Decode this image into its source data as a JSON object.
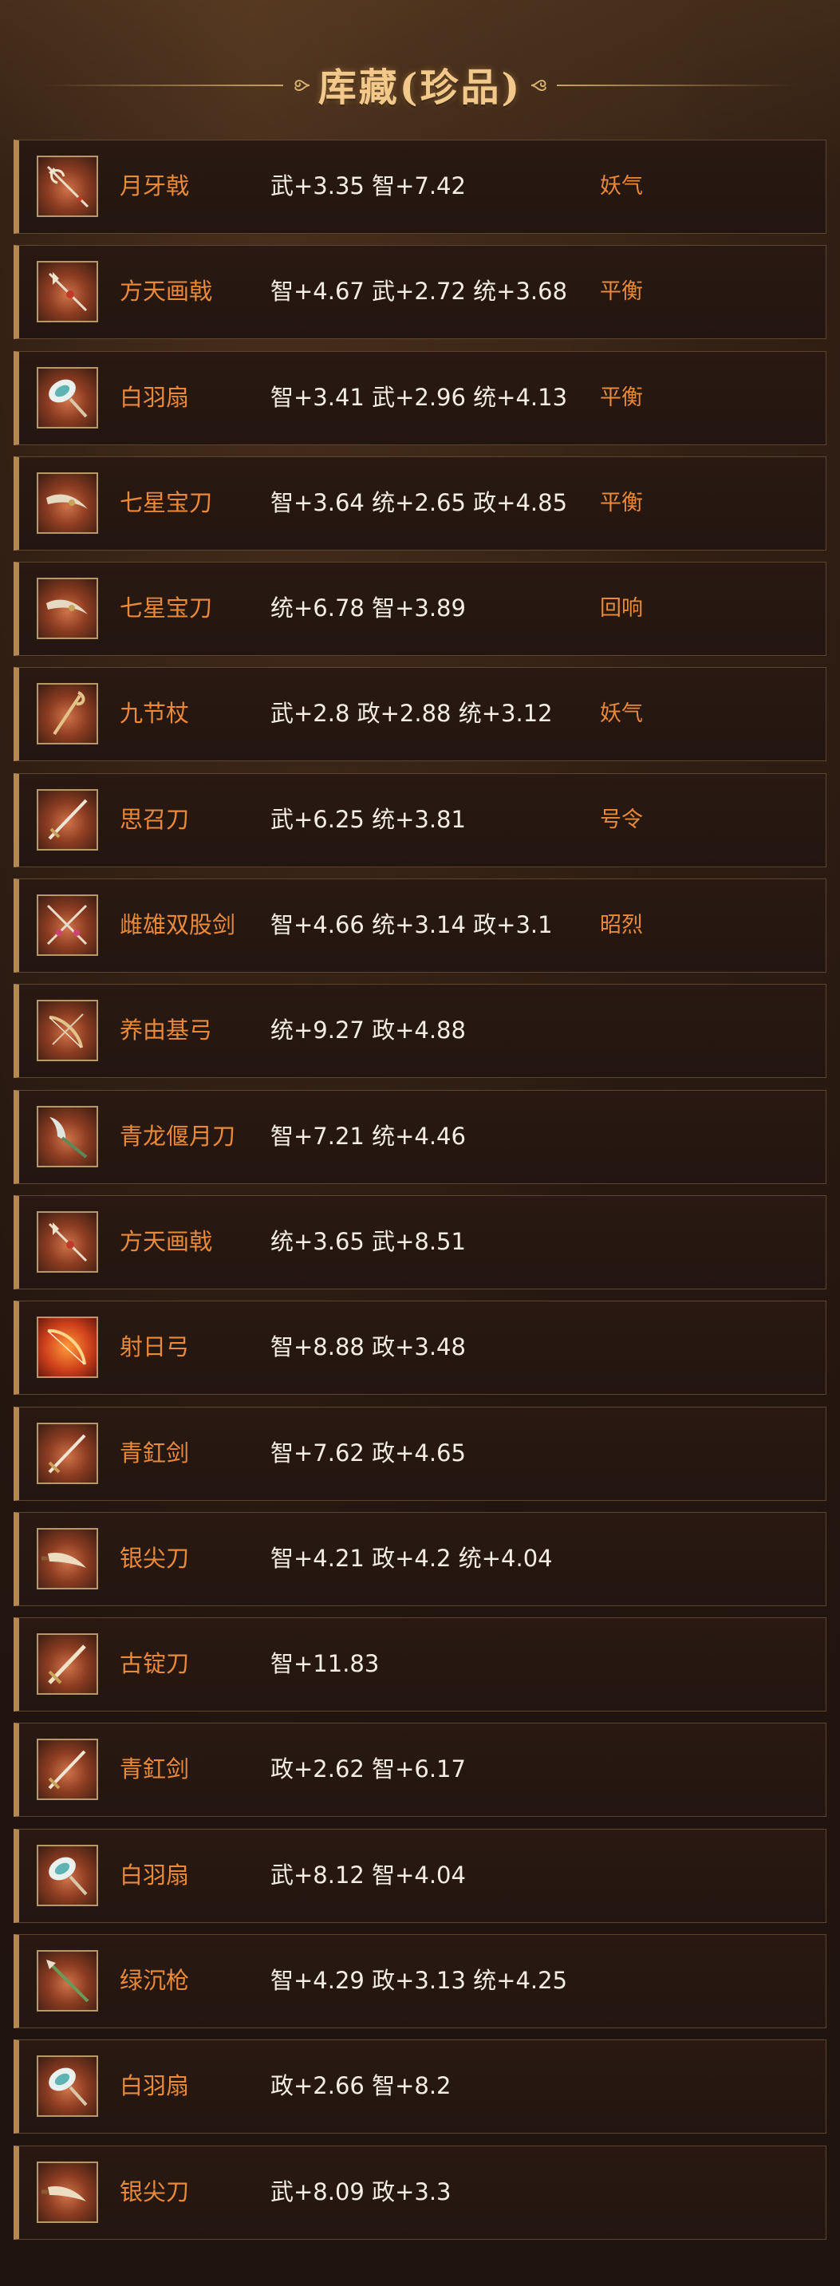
{
  "header": {
    "title": "库藏(珍品)"
  },
  "colors": {
    "item_name": "#e9893a",
    "stats_text": "#f3ede4",
    "title": "#f2c98a",
    "row_accent": "#b58850",
    "background": "#23150f"
  },
  "items": [
    {
      "name": "月牙戟",
      "stats": "武+3.35 智+7.42",
      "tag": "妖气",
      "icon": "halberd-icon"
    },
    {
      "name": "方天画戟",
      "stats": "智+4.67 武+2.72 统+3.68",
      "tag": "平衡",
      "icon": "halberd-icon"
    },
    {
      "name": "白羽扇",
      "stats": "智+3.41 武+2.96 统+4.13",
      "tag": "平衡",
      "icon": "feather-fan-icon"
    },
    {
      "name": "七星宝刀",
      "stats": "智+3.64 统+2.65 政+4.85",
      "tag": "平衡",
      "icon": "sword-icon"
    },
    {
      "name": "七星宝刀",
      "stats": "统+6.78 智+3.89",
      "tag": "回响",
      "icon": "sword-icon"
    },
    {
      "name": "九节杖",
      "stats": "武+2.8 政+2.88 统+3.12",
      "tag": "妖气",
      "icon": "staff-icon"
    },
    {
      "name": "思召刀",
      "stats": "武+6.25 统+3.81",
      "tag": "号令",
      "icon": "sword-icon"
    },
    {
      "name": "雌雄双股剑",
      "stats": "智+4.66 统+3.14 政+3.1",
      "tag": "昭烈",
      "icon": "twin-swords-icon"
    },
    {
      "name": "养由基弓",
      "stats": "统+9.27 政+4.88",
      "tag": "",
      "icon": "bow-icon"
    },
    {
      "name": "青龙偃月刀",
      "stats": "智+7.21 统+4.46",
      "tag": "",
      "icon": "glaive-icon"
    },
    {
      "name": "方天画戟",
      "stats": "统+3.65 武+8.51",
      "tag": "",
      "icon": "halberd-icon"
    },
    {
      "name": "射日弓",
      "stats": "智+8.88 政+3.48",
      "tag": "",
      "icon": "bow-icon"
    },
    {
      "name": "青釭剑",
      "stats": "智+7.62 政+4.65",
      "tag": "",
      "icon": "sword-icon"
    },
    {
      "name": "银尖刀",
      "stats": "智+4.21 政+4.2 统+4.04",
      "tag": "",
      "icon": "blade-icon"
    },
    {
      "name": "古锭刀",
      "stats": "智+11.83",
      "tag": "",
      "icon": "sword-icon"
    },
    {
      "name": "青釭剑",
      "stats": "政+2.62 智+6.17",
      "tag": "",
      "icon": "sword-icon"
    },
    {
      "name": "白羽扇",
      "stats": "武+8.12 智+4.04",
      "tag": "",
      "icon": "feather-fan-icon"
    },
    {
      "name": "绿沉枪",
      "stats": "智+4.29 政+3.13 统+4.25",
      "tag": "",
      "icon": "spear-icon"
    },
    {
      "name": "白羽扇",
      "stats": "政+2.66 智+8.2",
      "tag": "",
      "icon": "feather-fan-icon"
    },
    {
      "name": "银尖刀",
      "stats": "武+8.09 政+3.3",
      "tag": "",
      "icon": "blade-icon"
    }
  ]
}
